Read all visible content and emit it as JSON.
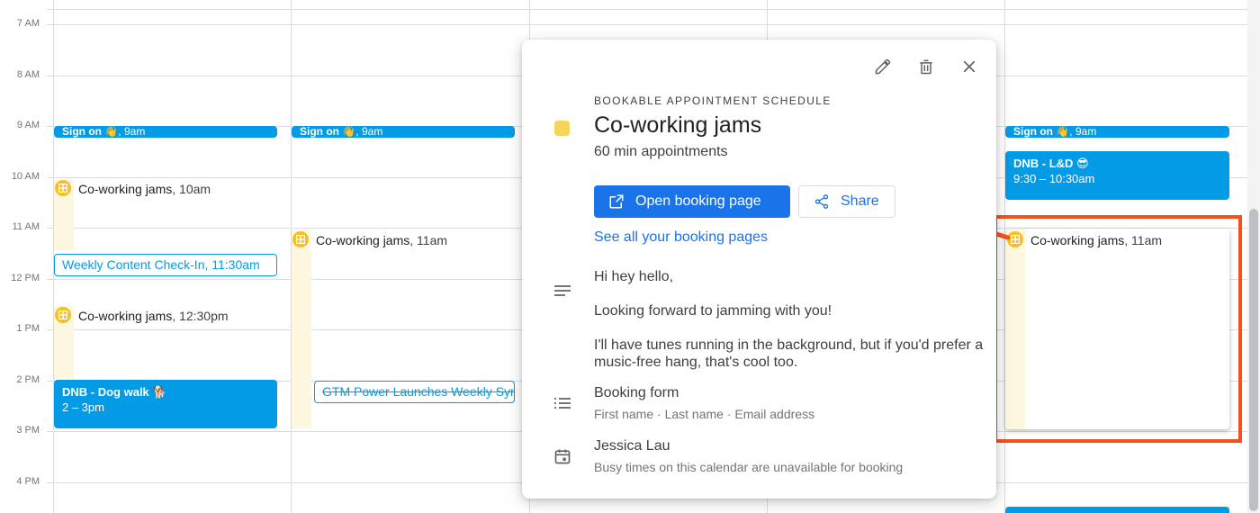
{
  "time_labels": [
    "7 AM",
    "8 AM",
    "9 AM",
    "10 AM",
    "11 AM",
    "12 PM",
    "1 PM",
    "2 PM",
    "3 PM",
    "4 PM"
  ],
  "events": {
    "signon_title": "Sign on",
    "signon_time": ", 9am",
    "appt_title": "Co-working jams",
    "appt_10": ", 10am",
    "appt_11": ", 11am",
    "appt_1230": ", 12:30pm",
    "weekly_checkin_title": "Weekly Content Check-In",
    "weekly_checkin_time": ", 11:30am",
    "dnb_dog_title": "DNB - Dog walk",
    "dnb_dog_time": "2 – 3pm",
    "gtm_title": "GTM Power Launches Weekly Sync",
    "dnb_ld_title": "DNB - L&D",
    "dnb_ld_time": "9:30 – 10:30am"
  },
  "popup": {
    "eyebrow": "BOOKABLE APPOINTMENT SCHEDULE",
    "title": "Co-working jams",
    "subtitle": "60 min appointments",
    "open_booking": "Open booking page",
    "share": "Share",
    "see_all": "See all your booking pages",
    "description": [
      "Hi hey hello,",
      "Looking forward to jamming with you!",
      "I'll have tunes running in the background, but if you'd prefer a music-free hang, that's cool too."
    ],
    "booking_form_title": "Booking form",
    "booking_form_fields": "First name · Last name · Email address",
    "calendar_owner": "Jessica Lau",
    "calendar_note": "Busy times on this calendar are unavailable for booking"
  },
  "colors": {
    "event_blue": "#039be5",
    "appointment_yellow": "#f6bf26",
    "primary_blue": "#1a73e8",
    "highlight_orange": "#f4511e"
  }
}
